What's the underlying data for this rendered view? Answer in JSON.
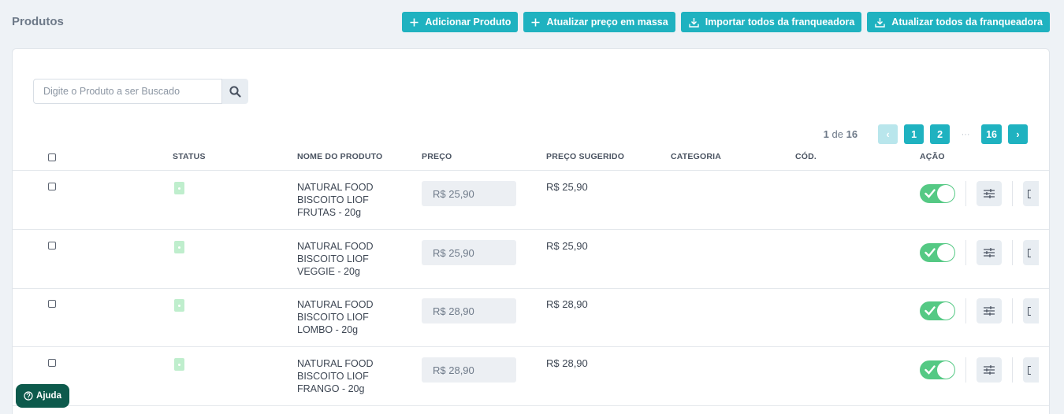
{
  "page": {
    "title": "Produtos"
  },
  "toolbar": {
    "add_product": "Adicionar Produto",
    "bulk_price_update": "Atualizar preço em massa",
    "import_all": "Importar todos da franqueadora",
    "update_all": "Atualizar todos da franqueadora"
  },
  "search": {
    "placeholder": "Digite o Produto a ser Buscado",
    "value": ""
  },
  "pagination": {
    "current": "1",
    "of": "de",
    "total": "16",
    "prev_icon": "chevron-left-icon",
    "next_icon": "chevron-right-icon",
    "prev_glyph": "‹",
    "next_glyph": "›",
    "pages": [
      "1",
      "2"
    ],
    "ellipsis": "···",
    "last": "16"
  },
  "table": {
    "columns": [
      "STATUS",
      "NOME DO PRODUTO",
      "PREÇO",
      "PREÇO SUGERIDO",
      "CATEGORIA",
      "CÓD.",
      "AÇÃO"
    ],
    "rows": [
      {
        "name_lines": [
          "NATURAL FOOD",
          "BISCOITO LIOF",
          "FRUTAS - 20g"
        ],
        "price": "R$ 25,90",
        "suggested_price": "R$ 25,90",
        "category": "",
        "code": "",
        "active": true
      },
      {
        "name_lines": [
          "NATURAL FOOD",
          "BISCOITO LIOF",
          "VEGGIE - 20g"
        ],
        "price": "R$ 25,90",
        "suggested_price": "R$ 25,90",
        "category": "",
        "code": "",
        "active": true
      },
      {
        "name_lines": [
          "NATURAL FOOD",
          "BISCOITO LIOF",
          "LOMBO - 20g"
        ],
        "price": "R$ 28,90",
        "suggested_price": "R$ 28,90",
        "category": "",
        "code": "",
        "active": true
      },
      {
        "name_lines": [
          "NATURAL FOOD",
          "BISCOITO LIOF",
          "FRANGO - 20g"
        ],
        "price": "R$ 28,90",
        "suggested_price": "R$ 28,90",
        "category": "",
        "code": "",
        "active": true
      }
    ]
  },
  "help": {
    "label": "Ajuda"
  },
  "colors": {
    "primary": "#1fb2c0",
    "primary_disabled": "#b9e6ec",
    "toggle_on": "#55c984",
    "status_active": "#bfeecd",
    "help_bg": "#0d5a4c",
    "page_bg": "#eef2f6"
  }
}
